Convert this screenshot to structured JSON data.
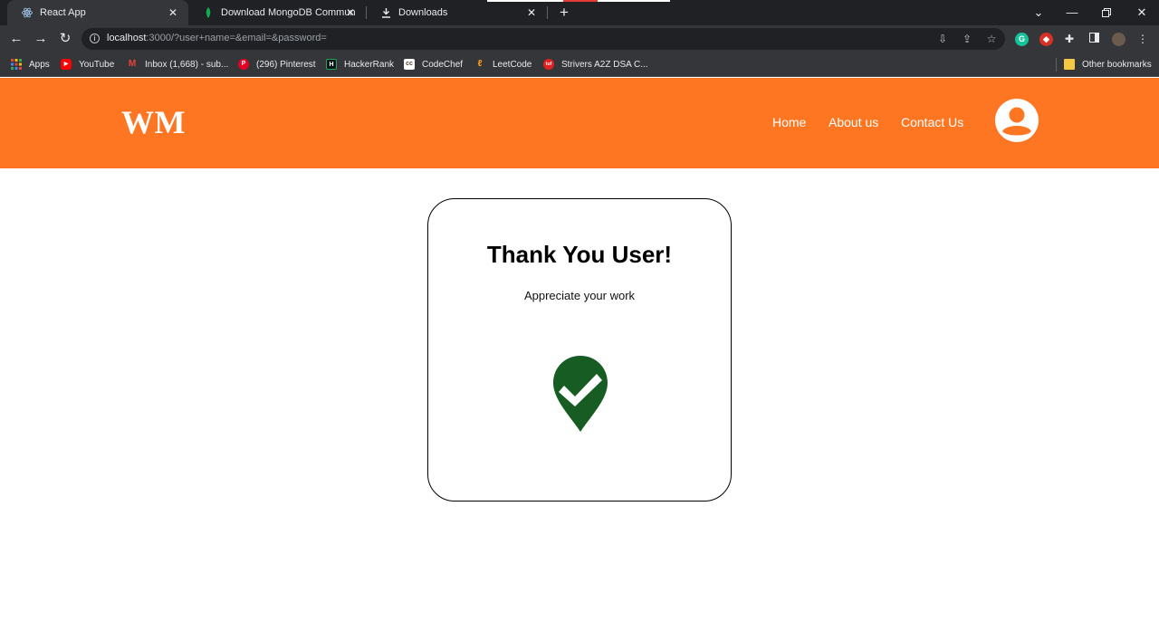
{
  "browser": {
    "tabs": [
      {
        "title": "React App",
        "icon": "react-icon",
        "active": true
      },
      {
        "title": "Download MongoDB Community",
        "icon": "mongodb-leaf-icon",
        "active": false
      },
      {
        "title": "Downloads",
        "icon": "download-icon",
        "active": false
      }
    ],
    "url": {
      "host": "localhost",
      "rest": ":3000/?user+name=&email=&password="
    },
    "bookmarks": [
      {
        "label": "Apps",
        "icon": "apps-grid-icon",
        "color": "#e8453c"
      },
      {
        "label": "YouTube",
        "icon": "youtube-icon",
        "color": "#ff0000"
      },
      {
        "label": "Inbox (1,668) - sub...",
        "icon": "gmail-icon",
        "color": "#ffffff"
      },
      {
        "label": "(296) Pinterest",
        "icon": "pinterest-icon",
        "color": "#e60023"
      },
      {
        "label": "HackerRank",
        "icon": "hackerrank-icon",
        "color": "#0e141e"
      },
      {
        "label": "CodeChef",
        "icon": "codechef-icon",
        "color": "#ffffff"
      },
      {
        "label": "LeetCode",
        "icon": "leetcode-icon",
        "color": "#ffa116"
      },
      {
        "label": "Strivers A2Z DSA C...",
        "icon": "tuf-icon",
        "color": "#e0211f"
      },
      {
        "label": "Other bookmarks",
        "icon": "folder-icon",
        "color": "#f4c842"
      }
    ]
  },
  "header": {
    "logo": "WM",
    "nav": [
      "Home",
      "About us",
      "Contact Us"
    ],
    "bg_color": "#ff7622"
  },
  "card": {
    "title": "Thank You User!",
    "subtitle": "Appreciate your work",
    "icon": "check-pin-icon",
    "icon_color": "#165c23"
  }
}
